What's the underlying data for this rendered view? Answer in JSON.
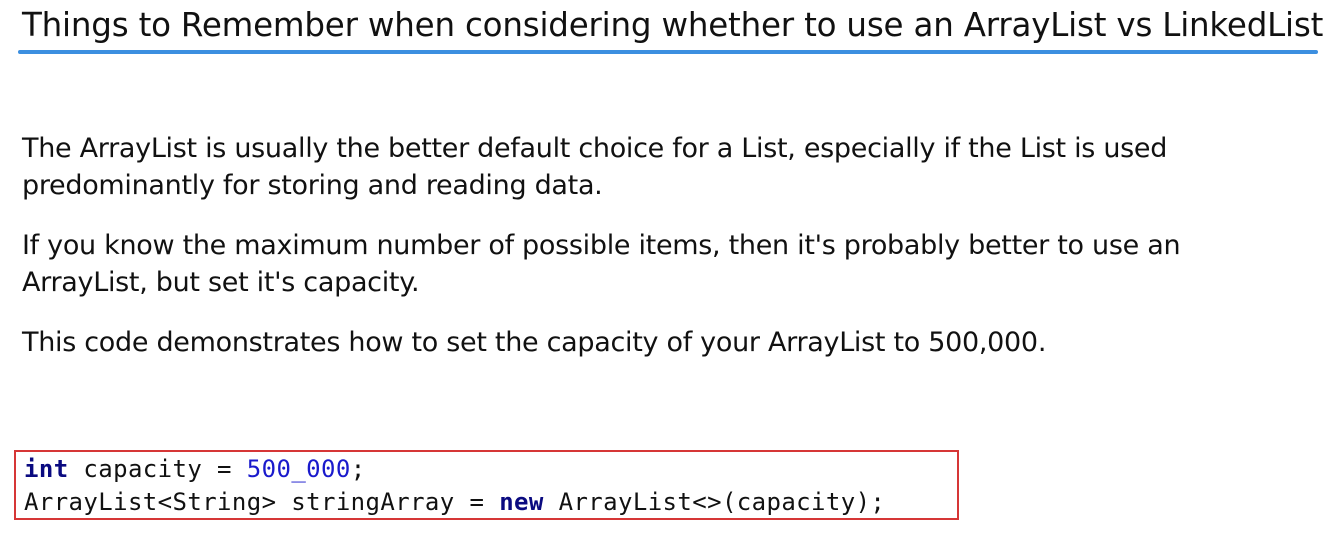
{
  "title": "Things to Remember when considering whether to use an ArrayList vs LinkedList",
  "accent_color": "#3c8fe0",
  "highlight_border_color": "#d63636",
  "paragraphs": [
    "The ArrayList is usually the better default choice for a List, especially if the List is used predominantly for storing and reading data.",
    "If you know the maximum number of possible items, then it's probably better to use an ArrayList, but set it's capacity.",
    "This code demonstrates how to set the capacity of your ArrayList to 500,000."
  ],
  "code": {
    "line1": {
      "keyword": "int",
      "text_before_number": " capacity = ",
      "number": "500_000",
      "text_after_number": ";"
    },
    "line2": {
      "text_before_keyword": "ArrayList<String> stringArray = ",
      "keyword": "new",
      "text_after_keyword": " ArrayList<>(capacity);"
    }
  }
}
